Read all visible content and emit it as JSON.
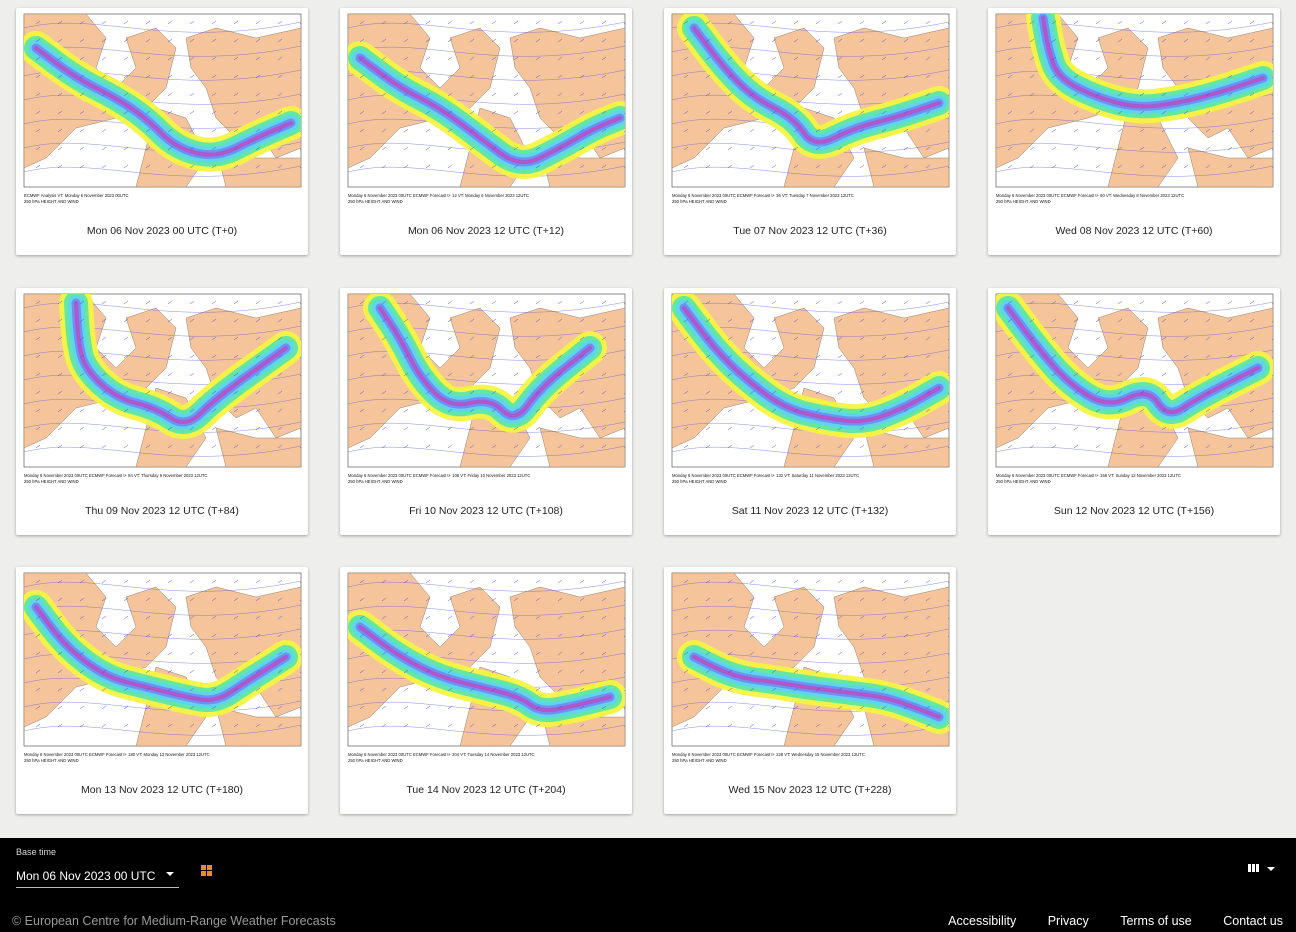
{
  "charts": [
    {
      "caption": "Mon 06 Nov 2023 00 UTC (T+0)",
      "header": "ECMWF Analysis VT: Monday 6 November 2023 00UTC",
      "subheader": "250 hPa HEIGHT AND WIND"
    },
    {
      "caption": "Mon 06 Nov 2023 12 UTC (T+12)",
      "header": "Monday 6 November 2023 00UTC ECMWF Forecast t+ 12 VT: Monday 6 November 2023 12UTC",
      "subheader": "250 hPa HEIGHT AND WIND"
    },
    {
      "caption": "Tue 07 Nov 2023 12 UTC (T+36)",
      "header": "Monday 6 November 2023 00UTC ECMWF Forecast t+ 36 VT: Tuesday 7 November 2023 12UTC",
      "subheader": "250 hPa HEIGHT AND WIND"
    },
    {
      "caption": "Wed 08 Nov 2023 12 UTC (T+60)",
      "header": "Monday 6 November 2023 00UTC ECMWF Forecast t+ 60 VT: Wednesday 8 November 2023 12UTC",
      "subheader": "250 hPa HEIGHT AND WIND"
    },
    {
      "caption": "Thu 09 Nov 2023 12 UTC (T+84)",
      "header": "Monday 6 November 2023 00UTC ECMWF Forecast t+ 84 VT: Thursday 9 November 2023 12UTC",
      "subheader": "250 hPa HEIGHT AND WIND"
    },
    {
      "caption": "Fri 10 Nov 2023 12 UTC (T+108)",
      "header": "Monday 6 November 2023 00UTC ECMWF Forecast t+ 108 VT: Friday 10 November 2023 12UTC",
      "subheader": "250 hPa HEIGHT AND WIND"
    },
    {
      "caption": "Sat 11 Nov 2023 12 UTC (T+132)",
      "header": "Monday 6 November 2023 00UTC ECMWF Forecast t+ 132 VT: Saturday 11 November 2023 12UTC",
      "subheader": "250 hPa HEIGHT AND WIND"
    },
    {
      "caption": "Sun 12 Nov 2023 12 UTC (T+156)",
      "header": "Monday 6 November 2023 00UTC ECMWF Forecast t+ 156 VT: Sunday 12 November 2023 12UTC",
      "subheader": "250 hPa HEIGHT AND WIND"
    },
    {
      "caption": "Mon 13 Nov 2023 12 UTC (T+180)",
      "header": "Monday 6 November 2023 00UTC ECMWF Forecast t+ 180 VT: Monday 13 November 2023 12UTC",
      "subheader": "250 hPa HEIGHT AND WIND"
    },
    {
      "caption": "Tue 14 Nov 2023 12 UTC (T+204)",
      "header": "Monday 6 November 2023 00UTC ECMWF Forecast t+ 204 VT: Tuesday 14 November 2023 12UTC",
      "subheader": "250 hPa HEIGHT AND WIND"
    },
    {
      "caption": "Wed 15 Nov 2023 12 UTC (T+228)",
      "header": "Monday 6 November 2023 00UTC ECMWF Forecast t+ 228 VT: Wednesday 15 November 2023 12UTC",
      "subheader": "250 hPa HEIGHT AND WIND"
    }
  ],
  "controls": {
    "base_time_label": "Base time",
    "base_time_value": "Mon 06 Nov 2023 00 UTC",
    "grid_view_icon": "grid-view-icon",
    "columns_icon": "view-columns-icon"
  },
  "footer": {
    "copyright": "© European Centre for Medium-Range Weather Forecasts",
    "links": [
      "Accessibility",
      "Privacy",
      "Terms of use",
      "Contact us"
    ]
  },
  "colors": {
    "land": "#f5c49a",
    "jet_yellow": "#f4f442",
    "jet_green": "#5be6a8",
    "jet_cyan": "#5fd4f0",
    "jet_blue": "#6f8cf0",
    "jet_purple": "#a05ad8",
    "jet_magenta": "#d04fb0",
    "accent": "#e58a2e",
    "bar_background": "#000000"
  }
}
